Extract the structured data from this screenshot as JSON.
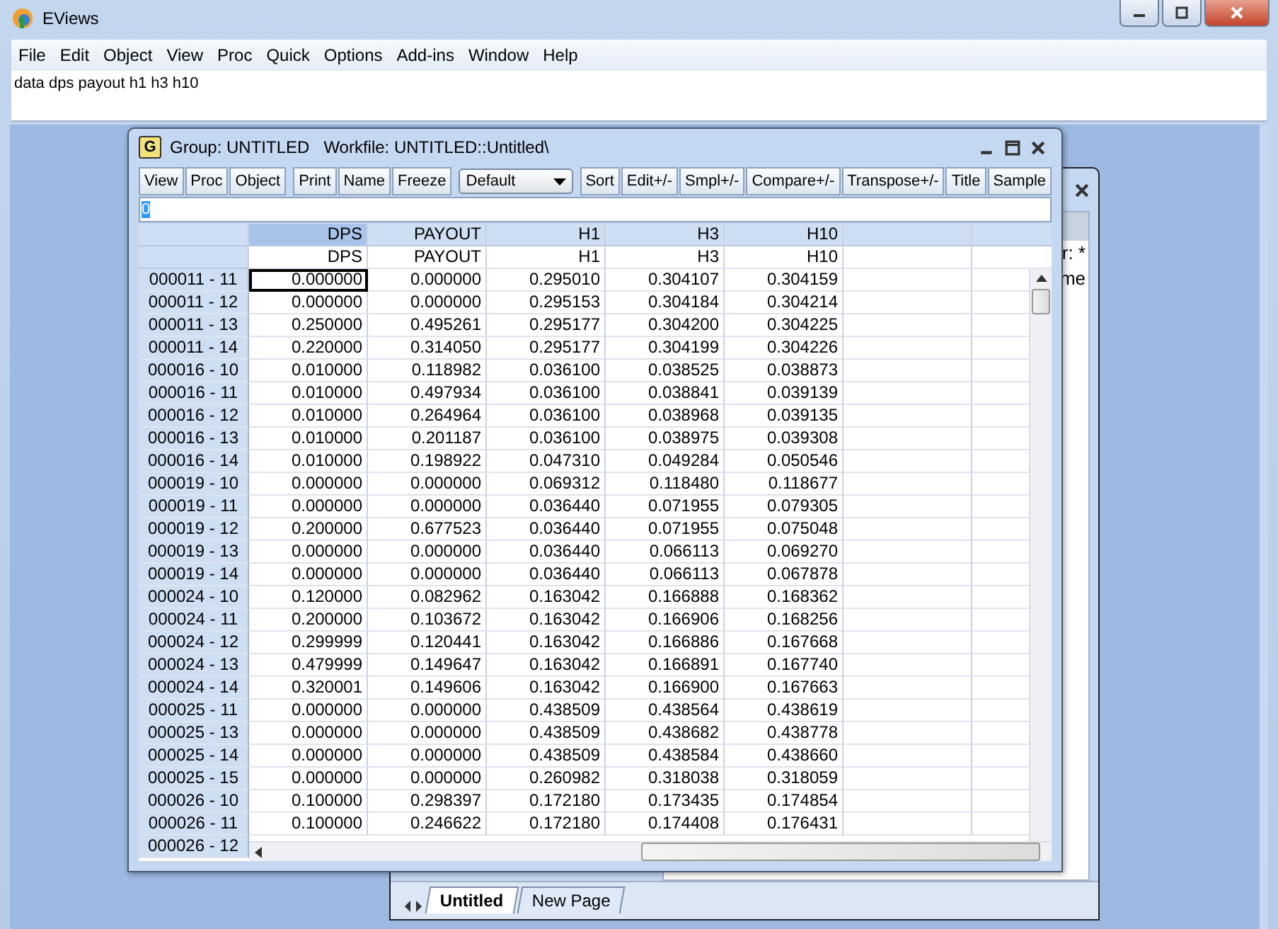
{
  "app": {
    "title": "EViews"
  },
  "menu": [
    "File",
    "Edit",
    "Object",
    "View",
    "Proc",
    "Quick",
    "Options",
    "Add-ins",
    "Window",
    "Help"
  ],
  "command": "data dps payout h1 h3 h10",
  "workfile_window": {
    "visible_texts": [
      "r: *",
      "me"
    ],
    "tabs": [
      {
        "label": "Untitled",
        "selected": true
      },
      {
        "label": "New Page",
        "selected": false
      }
    ]
  },
  "group_window": {
    "badge": "G",
    "title": "Group: UNTITLED   Workfile: UNTITLED::Untitled\\",
    "toolbar": [
      {
        "kind": "buttons",
        "items": [
          "View",
          "Proc",
          "Object"
        ]
      },
      {
        "kind": "buttons",
        "items": [
          "Print",
          "Name",
          "Freeze"
        ]
      },
      {
        "kind": "dropdown",
        "label": "Default"
      },
      {
        "kind": "buttons",
        "items": [
          "Sort",
          "Edit+/-",
          "Smpl+/-",
          "Compare+/-",
          "Transpose+/-",
          "Title",
          "Sample"
        ]
      }
    ],
    "edit_value": "0",
    "columns": [
      {
        "name": "DPS",
        "label": "DPS",
        "selected": true
      },
      {
        "name": "PAYOUT",
        "label": "PAYOUT",
        "selected": false
      },
      {
        "name": "H1",
        "label": "H1",
        "selected": false
      },
      {
        "name": "H3",
        "label": "H3",
        "selected": false
      },
      {
        "name": "H10",
        "label": "H10",
        "selected": false
      }
    ],
    "rows": [
      {
        "label": "000011 - 11",
        "cells": [
          "0.000000",
          "0.000000",
          "0.295010",
          "0.304107",
          "0.304159"
        ]
      },
      {
        "label": "000011 - 12",
        "cells": [
          "0.000000",
          "0.000000",
          "0.295153",
          "0.304184",
          "0.304214"
        ]
      },
      {
        "label": "000011 - 13",
        "cells": [
          "0.250000",
          "0.495261",
          "0.295177",
          "0.304200",
          "0.304225"
        ]
      },
      {
        "label": "000011 - 14",
        "cells": [
          "0.220000",
          "0.314050",
          "0.295177",
          "0.304199",
          "0.304226"
        ]
      },
      {
        "label": "000016 - 10",
        "cells": [
          "0.010000",
          "0.118982",
          "0.036100",
          "0.038525",
          "0.038873"
        ]
      },
      {
        "label": "000016 - 11",
        "cells": [
          "0.010000",
          "0.497934",
          "0.036100",
          "0.038841",
          "0.039139"
        ]
      },
      {
        "label": "000016 - 12",
        "cells": [
          "0.010000",
          "0.264964",
          "0.036100",
          "0.038968",
          "0.039135"
        ]
      },
      {
        "label": "000016 - 13",
        "cells": [
          "0.010000",
          "0.201187",
          "0.036100",
          "0.038975",
          "0.039308"
        ]
      },
      {
        "label": "000016 - 14",
        "cells": [
          "0.010000",
          "0.198922",
          "0.047310",
          "0.049284",
          "0.050546"
        ]
      },
      {
        "label": "000019 - 10",
        "cells": [
          "0.000000",
          "0.000000",
          "0.069312",
          "0.118480",
          "0.118677"
        ]
      },
      {
        "label": "000019 - 11",
        "cells": [
          "0.000000",
          "0.000000",
          "0.036440",
          "0.071955",
          "0.079305"
        ]
      },
      {
        "label": "000019 - 12",
        "cells": [
          "0.200000",
          "0.677523",
          "0.036440",
          "0.071955",
          "0.075048"
        ]
      },
      {
        "label": "000019 - 13",
        "cells": [
          "0.000000",
          "0.000000",
          "0.036440",
          "0.066113",
          "0.069270"
        ]
      },
      {
        "label": "000019 - 14",
        "cells": [
          "0.000000",
          "0.000000",
          "0.036440",
          "0.066113",
          "0.067878"
        ]
      },
      {
        "label": "000024 - 10",
        "cells": [
          "0.120000",
          "0.082962",
          "0.163042",
          "0.166888",
          "0.168362"
        ]
      },
      {
        "label": "000024 - 11",
        "cells": [
          "0.200000",
          "0.103672",
          "0.163042",
          "0.166906",
          "0.168256"
        ]
      },
      {
        "label": "000024 - 12",
        "cells": [
          "0.299999",
          "0.120441",
          "0.163042",
          "0.166886",
          "0.167668"
        ]
      },
      {
        "label": "000024 - 13",
        "cells": [
          "0.479999",
          "0.149647",
          "0.163042",
          "0.166891",
          "0.167740"
        ]
      },
      {
        "label": "000024 - 14",
        "cells": [
          "0.320001",
          "0.149606",
          "0.163042",
          "0.166900",
          "0.167663"
        ]
      },
      {
        "label": "000025 - 11",
        "cells": [
          "0.000000",
          "0.000000",
          "0.438509",
          "0.438564",
          "0.438619"
        ]
      },
      {
        "label": "000025 - 13",
        "cells": [
          "0.000000",
          "0.000000",
          "0.438509",
          "0.438682",
          "0.438778"
        ]
      },
      {
        "label": "000025 - 14",
        "cells": [
          "0.000000",
          "0.000000",
          "0.438509",
          "0.438584",
          "0.438660"
        ]
      },
      {
        "label": "000025 - 15",
        "cells": [
          "0.000000",
          "0.000000",
          "0.260982",
          "0.318038",
          "0.318059"
        ]
      },
      {
        "label": "000026 - 10",
        "cells": [
          "0.100000",
          "0.298397",
          "0.172180",
          "0.173435",
          "0.174854"
        ]
      },
      {
        "label": "000026 - 11",
        "cells": [
          "0.100000",
          "0.246622",
          "0.172180",
          "0.174408",
          "0.176431"
        ]
      },
      {
        "label": "000026 - 12",
        "cells": []
      }
    ]
  }
}
